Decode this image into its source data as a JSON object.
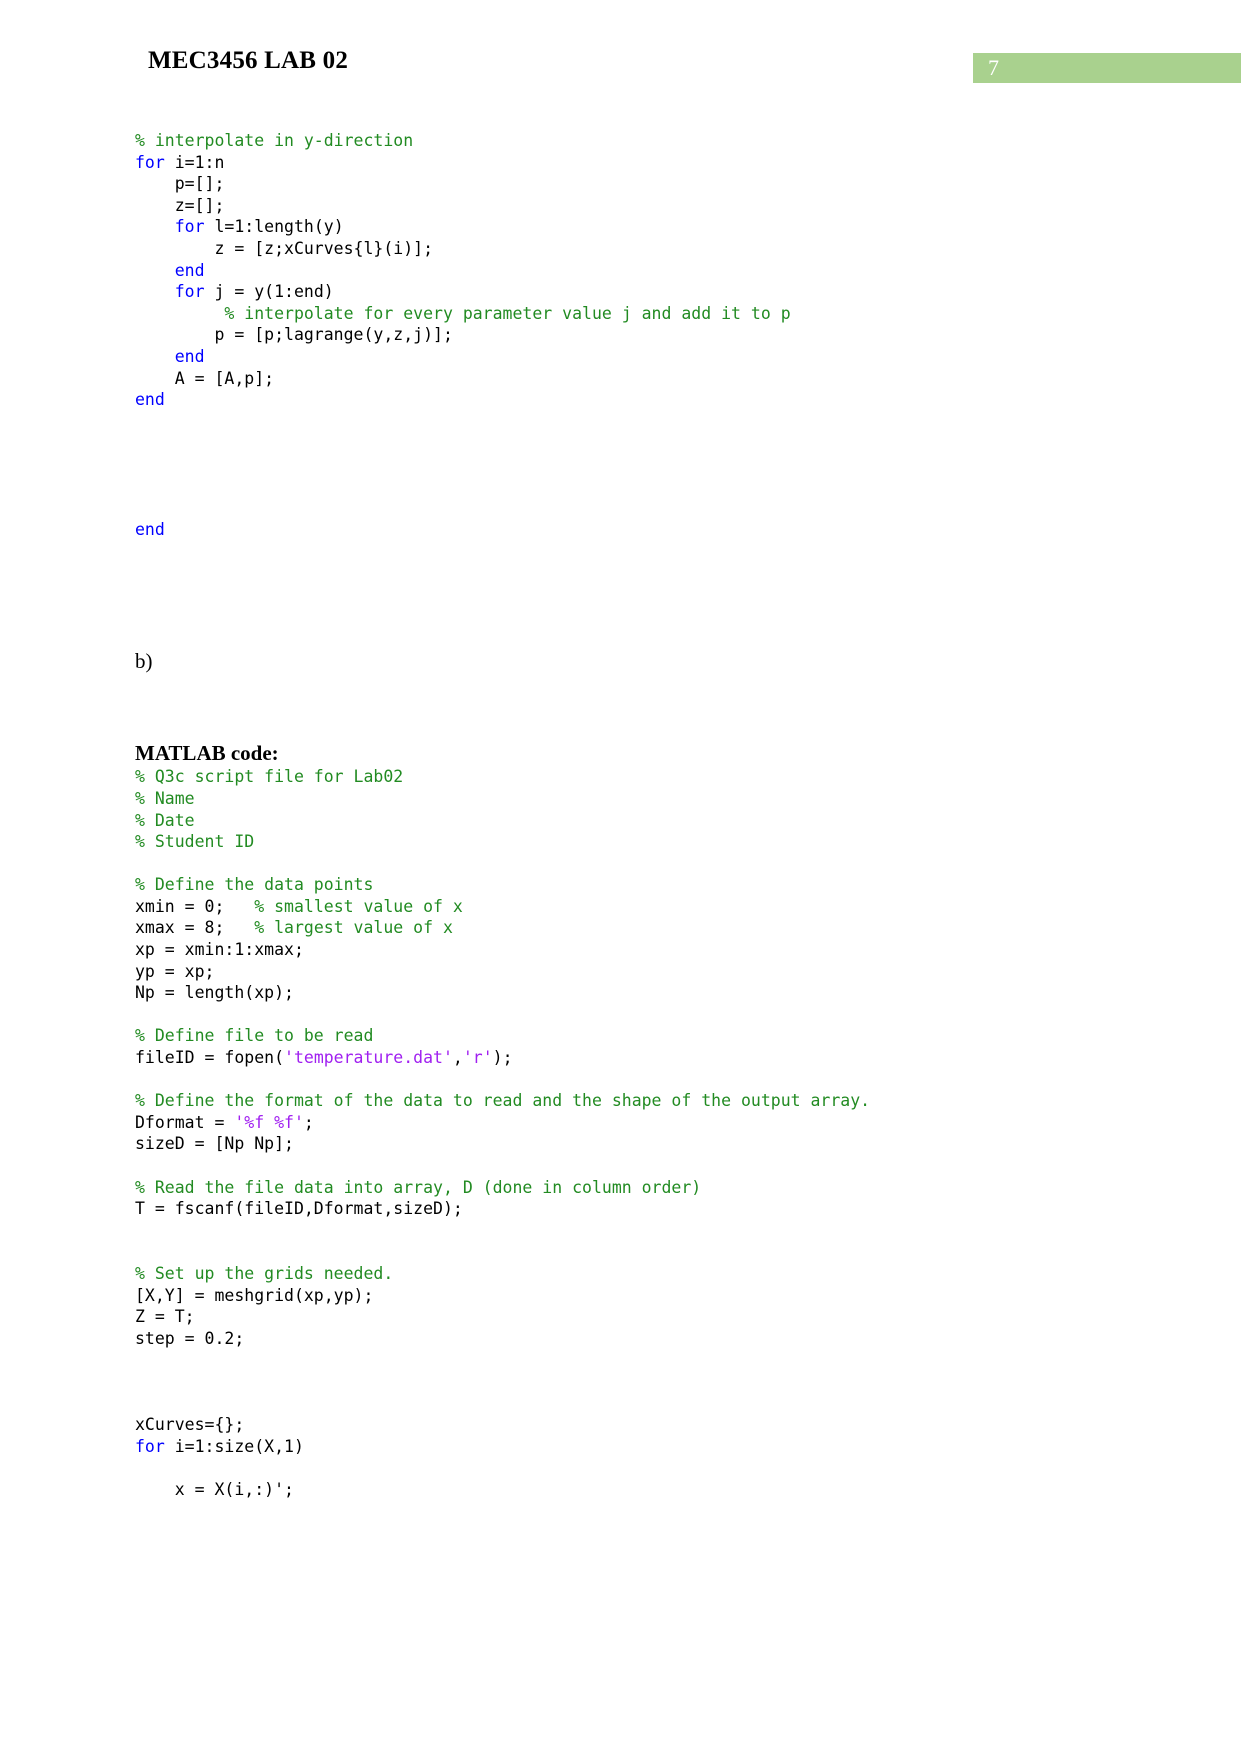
{
  "document": {
    "header_title": "MEC3456 LAB 02",
    "page_number": "7",
    "accent_color": "#a9d18e",
    "comment_color": "#228B22",
    "keyword_color": "#0000FF",
    "string_color": "#A020F0"
  },
  "block_a": {
    "lines": [
      [
        {
          "t": "% interpolate in y-direction",
          "c": "cm"
        }
      ],
      [
        {
          "t": "for",
          "c": "kw"
        },
        {
          "t": " i=1:n",
          "c": "pl"
        }
      ],
      [
        {
          "t": "    p=[];",
          "c": "pl"
        }
      ],
      [
        {
          "t": "    z=[];",
          "c": "pl"
        }
      ],
      [
        {
          "t": "    ",
          "c": "pl"
        },
        {
          "t": "for",
          "c": "kw"
        },
        {
          "t": " l=1:length(y)",
          "c": "pl"
        }
      ],
      [
        {
          "t": "        z = [z;xCurves{l}(i)];",
          "c": "pl"
        }
      ],
      [
        {
          "t": "    ",
          "c": "pl"
        },
        {
          "t": "end",
          "c": "kw"
        }
      ],
      [
        {
          "t": "    ",
          "c": "pl"
        },
        {
          "t": "for",
          "c": "kw"
        },
        {
          "t": " j = y(1:end)",
          "c": "pl"
        }
      ],
      [
        {
          "t": "         % interpolate for every parameter value j and add it to p",
          "c": "cm"
        }
      ],
      [
        {
          "t": "        p = [p;lagrange(y,z,j)];",
          "c": "pl"
        }
      ],
      [
        {
          "t": "    ",
          "c": "pl"
        },
        {
          "t": "end",
          "c": "kw"
        }
      ],
      [
        {
          "t": "    A = [A,p];",
          "c": "pl"
        }
      ],
      [
        {
          "t": "end",
          "c": "kw"
        }
      ]
    ]
  },
  "block_end": {
    "lines": [
      [
        {
          "t": "end",
          "c": "kw"
        }
      ]
    ]
  },
  "section_b": {
    "label": "b)"
  },
  "matlab_heading": {
    "label": "MATLAB code:"
  },
  "block_b": {
    "lines": [
      [
        {
          "t": "% Q3c script file for Lab02",
          "c": "cm"
        }
      ],
      [
        {
          "t": "% Name",
          "c": "cm"
        }
      ],
      [
        {
          "t": "% Date",
          "c": "cm"
        }
      ],
      [
        {
          "t": "% Student ID",
          "c": "cm"
        }
      ],
      [
        {
          "t": "",
          "c": "pl"
        }
      ],
      [
        {
          "t": "% Define the data points",
          "c": "cm"
        }
      ],
      [
        {
          "t": "xmin = 0;   ",
          "c": "pl"
        },
        {
          "t": "% smallest value of x",
          "c": "cm"
        }
      ],
      [
        {
          "t": "xmax = 8;   ",
          "c": "pl"
        },
        {
          "t": "% largest value of x",
          "c": "cm"
        }
      ],
      [
        {
          "t": "xp = xmin:1:xmax;",
          "c": "pl"
        }
      ],
      [
        {
          "t": "yp = xp;",
          "c": "pl"
        }
      ],
      [
        {
          "t": "Np = length(xp);",
          "c": "pl"
        }
      ],
      [
        {
          "t": "",
          "c": "pl"
        }
      ],
      [
        {
          "t": "% Define file to be read",
          "c": "cm"
        }
      ],
      [
        {
          "t": "fileID = fopen(",
          "c": "pl"
        },
        {
          "t": "'temperature.dat'",
          "c": "st"
        },
        {
          "t": ",",
          "c": "pl"
        },
        {
          "t": "'r'",
          "c": "st"
        },
        {
          "t": ");",
          "c": "pl"
        }
      ],
      [
        {
          "t": "",
          "c": "pl"
        }
      ],
      [
        {
          "t": "% Define the format of the data to read and the shape of the output array.",
          "c": "cm"
        }
      ],
      [
        {
          "t": "Dformat = ",
          "c": "pl"
        },
        {
          "t": "'%f %f'",
          "c": "st"
        },
        {
          "t": ";",
          "c": "pl"
        }
      ],
      [
        {
          "t": "sizeD = [Np Np];",
          "c": "pl"
        }
      ],
      [
        {
          "t": "",
          "c": "pl"
        }
      ],
      [
        {
          "t": "% Read the file data into array, D (done in column order)",
          "c": "cm"
        }
      ],
      [
        {
          "t": "T = fscanf(fileID,Dformat,sizeD);",
          "c": "pl"
        }
      ],
      [
        {
          "t": "",
          "c": "pl"
        }
      ],
      [
        {
          "t": "",
          "c": "pl"
        }
      ],
      [
        {
          "t": "% Set up the grids needed.",
          "c": "cm"
        }
      ],
      [
        {
          "t": "[X,Y] = meshgrid(xp,yp);",
          "c": "pl"
        }
      ],
      [
        {
          "t": "Z = T;",
          "c": "pl"
        }
      ],
      [
        {
          "t": "step = 0.2;",
          "c": "pl"
        }
      ],
      [
        {
          "t": "",
          "c": "pl"
        }
      ],
      [
        {
          "t": "",
          "c": "pl"
        }
      ],
      [
        {
          "t": "",
          "c": "pl"
        }
      ],
      [
        {
          "t": "xCurves={};",
          "c": "pl"
        }
      ],
      [
        {
          "t": "for",
          "c": "kw"
        },
        {
          "t": " i=1:size(X,1)",
          "c": "pl"
        }
      ],
      [
        {
          "t": "",
          "c": "pl"
        }
      ],
      [
        {
          "t": "    x = X(i,:)';",
          "c": "pl"
        }
      ]
    ]
  }
}
